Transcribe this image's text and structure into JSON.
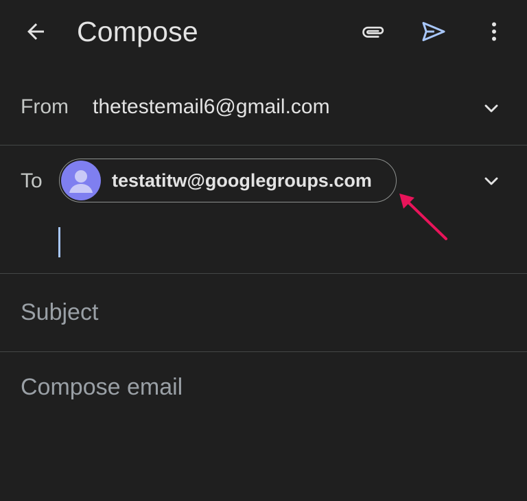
{
  "appbar": {
    "title": "Compose",
    "icons": {
      "back": "arrow-back-icon",
      "attach": "paperclip-icon",
      "send": "send-icon",
      "more": "more-vert-icon"
    }
  },
  "from": {
    "label": "From",
    "value": "thetestemail6@gmail.com"
  },
  "to": {
    "label": "To",
    "recipients": [
      {
        "address": "testatitw@googlegroups.com"
      }
    ]
  },
  "subject": {
    "placeholder": "Subject"
  },
  "body": {
    "placeholder": "Compose email"
  },
  "colors": {
    "background": "#1f1f1f",
    "send_icon": "#a8c7fa",
    "avatar": "#7f7ff0",
    "annotation_arrow": "#e8145a"
  }
}
